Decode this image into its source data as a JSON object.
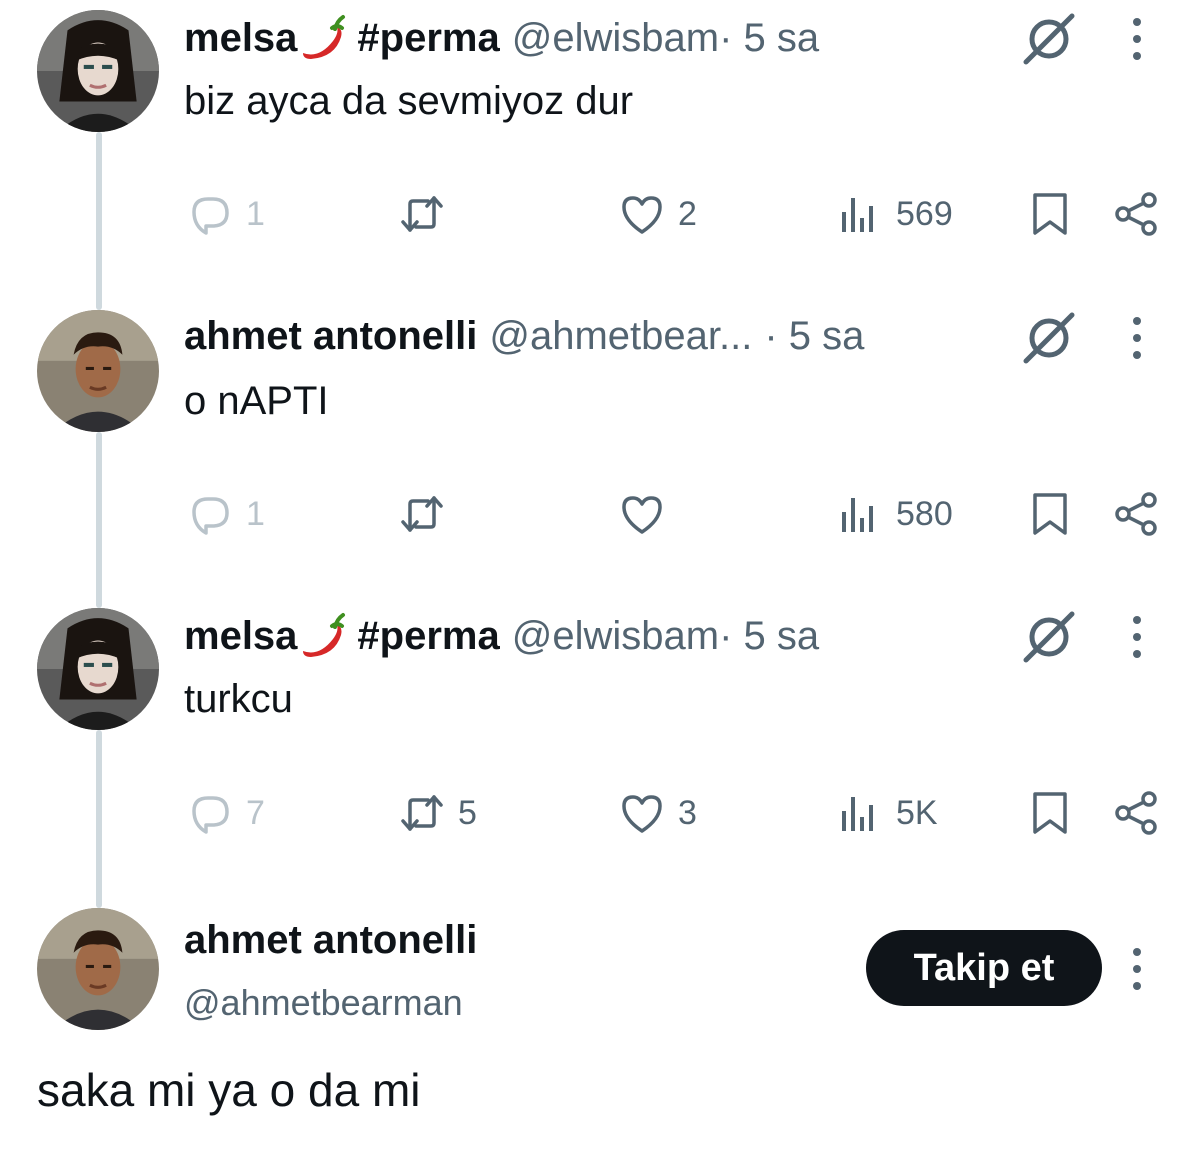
{
  "tweets": [
    {
      "user_name": "melsa",
      "name_emoji": "hot-pepper",
      "name_suffix": "#perma",
      "handle": "@elwisbam",
      "time": " · 5 sa",
      "text": "biz ayca da sevmiyoz dur",
      "replies": "1",
      "retweets": "",
      "likes": "2",
      "views": "569"
    },
    {
      "user_name": "ahmet antonelli",
      "handle": "@ahmetbear...",
      "time": " · 5 sa",
      "text": "o nAPTI",
      "replies": "1",
      "retweets": "",
      "likes": "",
      "views": "580"
    },
    {
      "user_name": "melsa",
      "name_emoji": "hot-pepper",
      "name_suffix": "#perma",
      "handle": "@elwisbam",
      "time": " · 5 sa",
      "text": "turkcu",
      "replies": "7",
      "retweets": "5",
      "likes": "3",
      "views": "5K"
    }
  ],
  "main_tweet": {
    "user_name": "ahmet antonelli",
    "handle": "@ahmetbearman",
    "follow_label": "Takip et",
    "text": "saka mi ya o da mi"
  },
  "icons": {
    "reply": "reply-icon",
    "retweet": "retweet-icon",
    "like": "like-icon",
    "views": "views-icon",
    "bookmark": "bookmark-icon",
    "share": "share-icon",
    "grok": "grok-icon",
    "more": "more-icon"
  },
  "colors": {
    "text": "#0f1419",
    "secondary": "#536471",
    "thread_line": "#cfd9de",
    "follow_button_bg": "#0f1419"
  }
}
